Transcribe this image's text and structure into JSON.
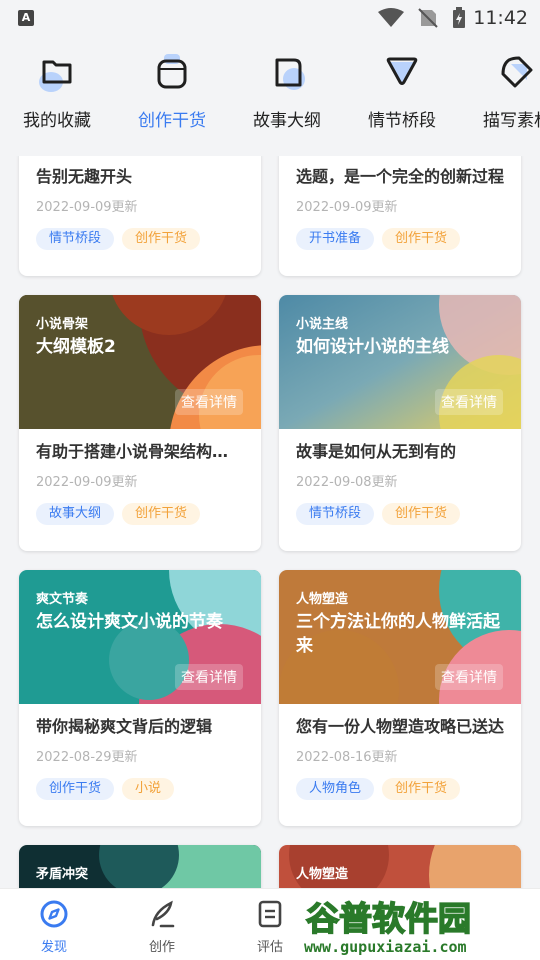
{
  "status_bar": {
    "time": "11:42",
    "app_badge": "A",
    "icons": [
      "wifi-icon",
      "no-signal-icon",
      "battery-charging-icon"
    ]
  },
  "categories": [
    {
      "label": "我的收藏",
      "icon": "folder-icon",
      "active": false
    },
    {
      "label": "创作干货",
      "icon": "box-icon",
      "active": true
    },
    {
      "label": "故事大纲",
      "icon": "outline-card-icon",
      "active": false
    },
    {
      "label": "情节桥段",
      "icon": "funnel-icon",
      "active": false
    },
    {
      "label": "描写素材",
      "icon": "tag-icon",
      "active": false
    }
  ],
  "cards": [
    {
      "has_cover": false,
      "desc": "告别无趣开头",
      "date": "2022-09-09更新",
      "tags": [
        "情节桥段",
        "创作干货"
      ]
    },
    {
      "has_cover": false,
      "desc": "选题，是一个完全的创新过程",
      "date": "2022-09-09更新",
      "tags": [
        "开书准备",
        "创作干货"
      ]
    },
    {
      "has_cover": true,
      "cover_tag": "小说骨架",
      "cover_title": "大纲模板2",
      "detail": "查看详情",
      "desc": "有助于搭建小说骨架结构，快速成文",
      "date": "2022-09-09更新",
      "tags": [
        "故事大纲",
        "创作干货"
      ]
    },
    {
      "has_cover": true,
      "cover_tag": "小说主线",
      "cover_title": "如何设计小说的主线",
      "detail": "查看详情",
      "desc": "故事是如何从无到有的",
      "date": "2022-09-08更新",
      "tags": [
        "情节桥段",
        "创作干货"
      ]
    },
    {
      "has_cover": true,
      "cover_tag": "爽文节奏",
      "cover_title": "怎么设计爽文小说的节奏",
      "detail": "查看详情",
      "desc": "带你揭秘爽文背后的逻辑",
      "date": "2022-08-29更新",
      "tags": [
        "创作干货",
        "小说"
      ]
    },
    {
      "has_cover": true,
      "cover_tag": "人物塑造",
      "cover_title": "三个方法让你的人物鲜活起来",
      "detail": "查看详情",
      "desc": "您有一份人物塑造攻略已送达",
      "date": "2022-08-16更新",
      "tags": [
        "人物角色",
        "创作干货"
      ]
    },
    {
      "has_cover": true,
      "cover_tag": "矛盾冲突",
      "cover_title": "",
      "detail": "",
      "desc": "",
      "date": "",
      "tags": []
    },
    {
      "has_cover": true,
      "cover_tag": "人物塑造",
      "cover_title": "",
      "detail": "",
      "desc": "",
      "date": "",
      "tags": []
    }
  ],
  "tabs": [
    {
      "label": "发现",
      "icon": "compass-icon",
      "active": true
    },
    {
      "label": "创作",
      "icon": "quill-icon",
      "active": false
    },
    {
      "label": "评估",
      "icon": "document-icon",
      "active": false
    }
  ],
  "watermark": {
    "line1": "谷普软件园",
    "line2": "www.gupuxiazai.com"
  },
  "colors": {
    "accent": "#3a7bf0",
    "tag_blue_bg": "#eaf1fd",
    "tag_orange_bg": "#fff4e2",
    "tag_orange_text": "#f2a23a"
  }
}
